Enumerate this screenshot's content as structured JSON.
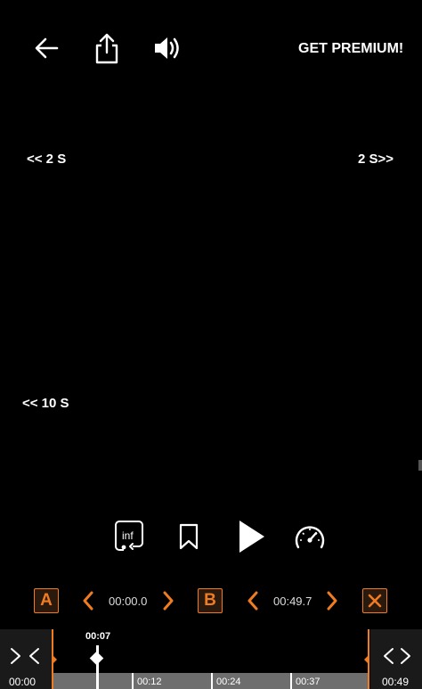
{
  "topbar": {
    "premium_label": "GET PREMIUM!"
  },
  "seek": {
    "back_2s": "<< 2 S",
    "forward_2s": "2 S>>",
    "back_10s": "<< 10 S"
  },
  "controls": {
    "loop_icon_label": "inf"
  },
  "ab_repeat": {
    "a_label": "A",
    "a_time": "00:00.0",
    "b_label": "B",
    "b_time": "00:49.7"
  },
  "timeline": {
    "current_time": "00:07",
    "start_time": "00:00",
    "end_time": "00:49",
    "tick_labels": [
      "00:12",
      "00:24",
      "00:37"
    ],
    "progress_fraction": 0.14
  },
  "colors": {
    "accent": "#f07c22",
    "background": "#000000"
  }
}
